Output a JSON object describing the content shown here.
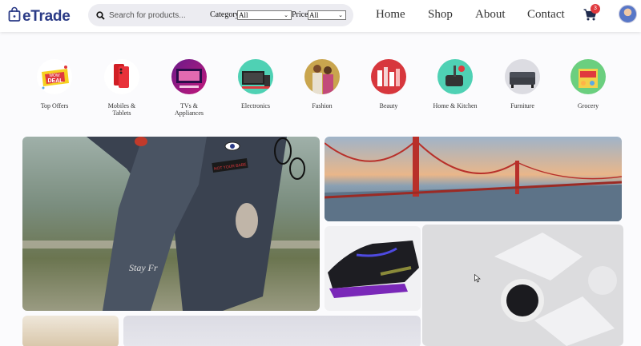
{
  "header": {
    "brand": "eTrade",
    "search_placeholder": "Search for products...",
    "category_label": "Category:",
    "category_value": "All",
    "price_label": "Price:",
    "price_value": "All",
    "nav": [
      "Home",
      "Shop",
      "About",
      "Contact"
    ],
    "cart_count": "3",
    "icons": {
      "logo": "shopping-bag-icon",
      "search": "search-icon",
      "cart": "cart-icon"
    }
  },
  "categories": [
    {
      "label": "Top Offers",
      "label2": ""
    },
    {
      "label": "Mobiles &",
      "label2": "Tablets"
    },
    {
      "label": "TVs &",
      "label2": "Appliances"
    },
    {
      "label": "Electronics",
      "label2": ""
    },
    {
      "label": "Fashion",
      "label2": ""
    },
    {
      "label": "Beauty",
      "label2": ""
    },
    {
      "label": "Home & Kitchen",
      "label2": ""
    },
    {
      "label": "Furniture",
      "label2": ""
    },
    {
      "label": "Grocery",
      "label2": ""
    }
  ],
  "offer_badge": {
    "line1": "WOW",
    "line2": "DEAL"
  },
  "banner_texts": {
    "patch": "NOT YOUR BABE",
    "script": "Stay Fr"
  },
  "colors": {
    "brand": "#2a3a86",
    "badge": "#e0393e",
    "search_bg": "#ececf1"
  }
}
